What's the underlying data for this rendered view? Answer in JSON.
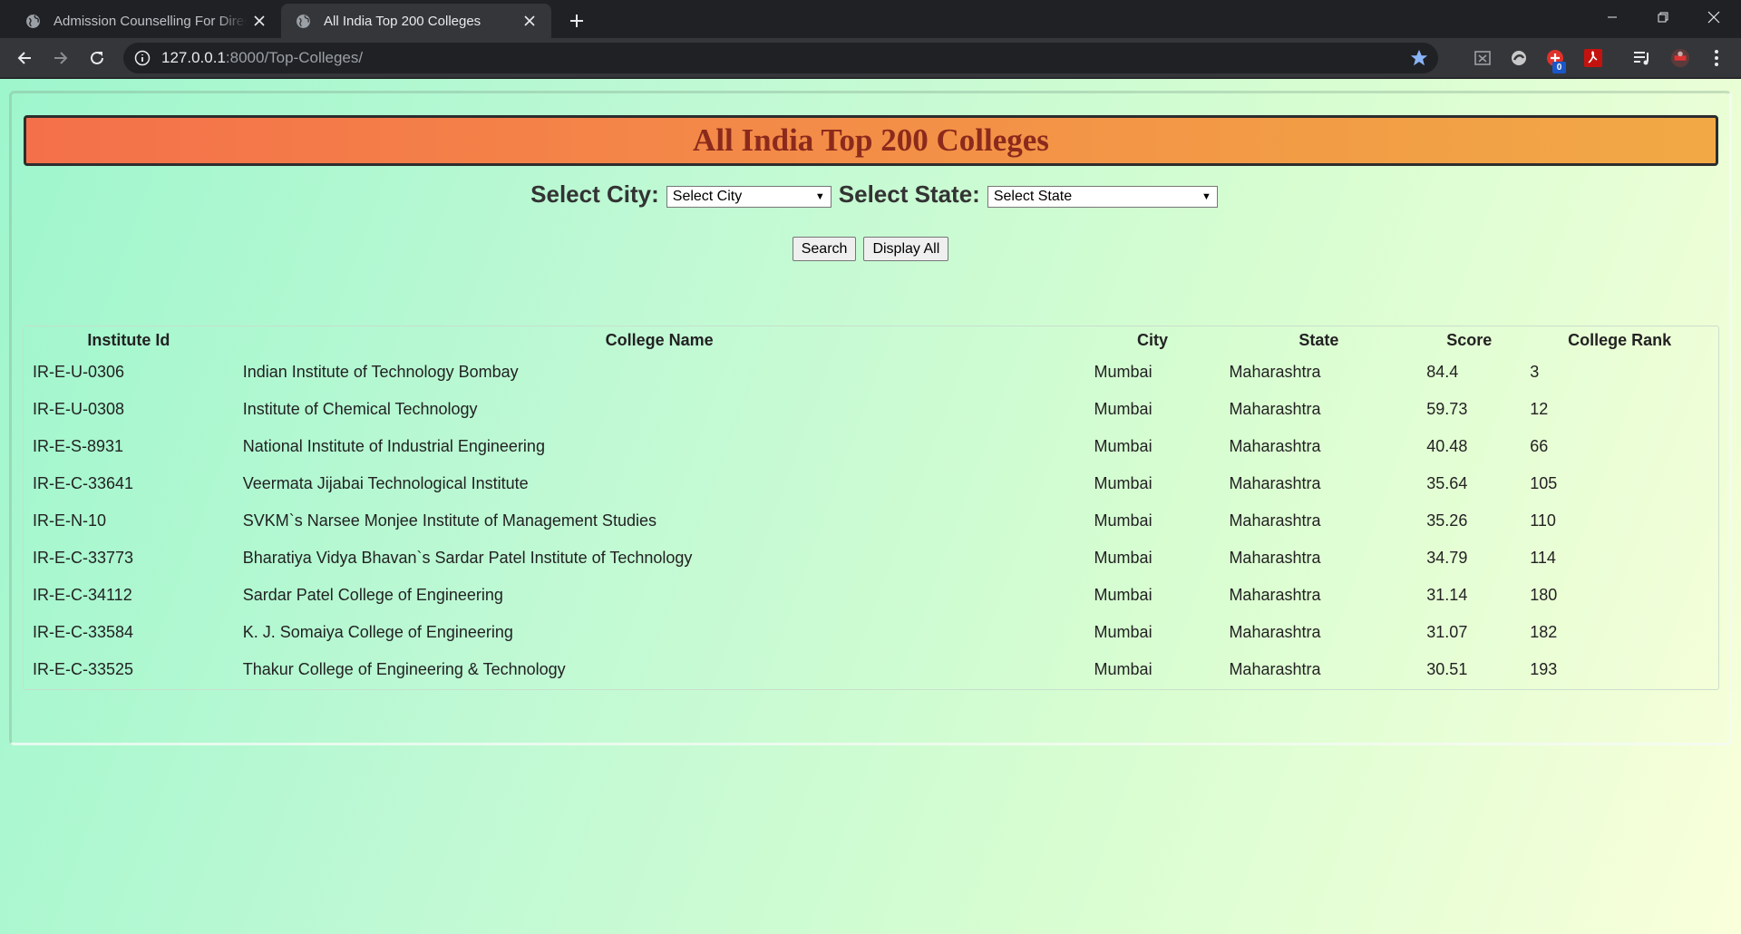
{
  "browser": {
    "tabs": [
      {
        "title": "Admission Counselling For Direct",
        "active": false
      },
      {
        "title": "All India Top 200 Colleges",
        "active": true
      }
    ],
    "url_host": "127.0.0.1",
    "url_path": ":8000/Top-Colleges/",
    "extension_badge": "0"
  },
  "page": {
    "heading": "All India Top 200 Colleges",
    "filters": {
      "city_label": "Select City:",
      "city_value": "Select City",
      "state_label": "Select State:",
      "state_value": "Select State"
    },
    "buttons": {
      "search": "Search",
      "display_all": "Display All"
    },
    "table": {
      "headers": [
        "Institute Id",
        "College Name",
        "City",
        "State",
        "Score",
        "College Rank"
      ],
      "rows": [
        [
          "IR-E-U-0306",
          "Indian Institute of Technology Bombay",
          "Mumbai",
          "Maharashtra",
          "84.4",
          "3"
        ],
        [
          "IR-E-U-0308",
          "Institute of Chemical Technology",
          "Mumbai",
          "Maharashtra",
          "59.73",
          "12"
        ],
        [
          "IR-E-S-8931",
          "National Institute of Industrial Engineering",
          "Mumbai",
          "Maharashtra",
          "40.48",
          "66"
        ],
        [
          "IR-E-C-33641",
          "Veermata Jijabai Technological Institute",
          "Mumbai",
          "Maharashtra",
          "35.64",
          "105"
        ],
        [
          "IR-E-N-10",
          "SVKM`s Narsee Monjee Institute of Management Studies",
          "Mumbai",
          "Maharashtra",
          "35.26",
          "110"
        ],
        [
          "IR-E-C-33773",
          "Bharatiya Vidya Bhavan`s Sardar Patel Institute of Technology",
          "Mumbai",
          "Maharashtra",
          "34.79",
          "114"
        ],
        [
          "IR-E-C-34112",
          "Sardar Patel College of Engineering",
          "Mumbai",
          "Maharashtra",
          "31.14",
          "180"
        ],
        [
          "IR-E-C-33584",
          "K. J. Somaiya College of Engineering",
          "Mumbai",
          "Maharashtra",
          "31.07",
          "182"
        ],
        [
          "IR-E-C-33525",
          "Thakur College of Engineering & Technology",
          "Mumbai",
          "Maharashtra",
          "30.51",
          "193"
        ]
      ]
    }
  },
  "colors": {
    "banner_start": "#f4704a",
    "banner_end": "#f2a945",
    "heading_text": "#8b2a1c",
    "bg_start": "#9ef6cd",
    "bg_end": "#f9ffda"
  }
}
